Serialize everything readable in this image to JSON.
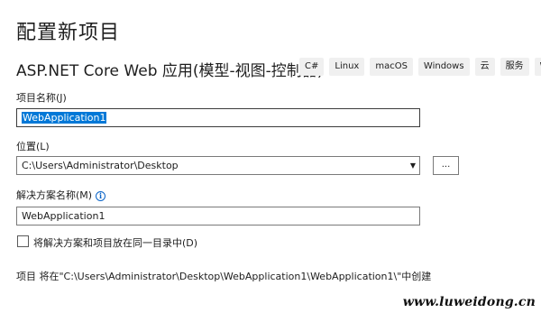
{
  "page": {
    "title": "配置新项目"
  },
  "template": {
    "name": "ASP.NET Core Web 应用(模型-视图-控制器)",
    "tags": [
      "C#",
      "Linux",
      "macOS",
      "Windows",
      "云",
      "服务",
      "W"
    ]
  },
  "form": {
    "project_name": {
      "label": "项目名称(J)",
      "value": "WebApplication1"
    },
    "location": {
      "label": "位置(L)",
      "value": "C:\\Users\\Administrator\\Desktop",
      "browse_label": "..."
    },
    "solution_name": {
      "label": "解决方案名称(M)",
      "value": "WebApplication1",
      "info_icon": "i"
    },
    "same_directory": {
      "label": "将解决方案和项目放在同一目录中(D)",
      "checked": false
    },
    "summary": "项目 将在\"C:\\Users\\Administrator\\Desktop\\WebApplication1\\WebApplication1\\\"中创建"
  },
  "watermark": "www.luweidong.cn"
}
